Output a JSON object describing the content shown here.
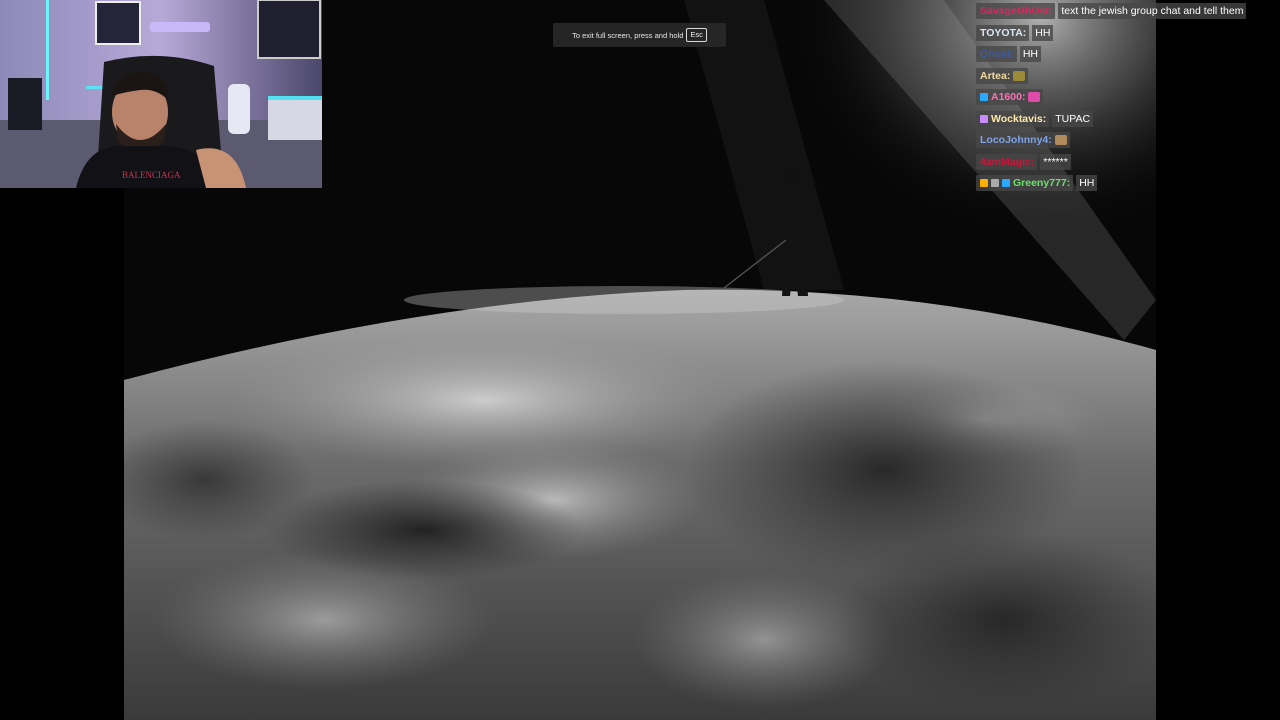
{
  "fullscreen_toast": {
    "text": "To exit full screen, press and hold",
    "key": "Esc"
  },
  "chat": {
    "messages": [
      {
        "user": "SavageGhOst:",
        "color": "#e0245e",
        "text": "text the jewish group chat and tell them",
        "badges": []
      },
      {
        "user": "TOYOTA:",
        "color": "#d8e6f2",
        "text": "HH",
        "badges": []
      },
      {
        "user": "Ghost:",
        "color": "#3d5a9e",
        "text": "HH",
        "badges": []
      },
      {
        "user": "Artea:",
        "color": "#f0d9a0",
        "text": "",
        "emote": "smirk-emote",
        "badges": []
      },
      {
        "user": "A1600:",
        "color": "#ff6fb5",
        "text": "",
        "emote": "pink-emote",
        "badges": [
          "diamond-badge"
        ]
      },
      {
        "user": "Wocktavis:",
        "color": "#ffe9a8",
        "text": "TUPAC",
        "badges": [
          "music-note-badge"
        ]
      },
      {
        "user": "LocoJohnny4:",
        "color": "#7fa2e8",
        "text": "",
        "emote": "monkey-emote",
        "badges": []
      },
      {
        "user": "4amMagic:",
        "color": "#c2183a",
        "text": "******",
        "badges": []
      },
      {
        "user": "Greeny777:",
        "color": "#6fe06f",
        "text": "HH",
        "badges": [
          "crown-badge",
          "slash-badge",
          "diamond-badge"
        ]
      }
    ]
  },
  "colors": {
    "toast_bg": "#282828",
    "chat_pill_bg": "#464646",
    "stage_bg": "#000000"
  }
}
